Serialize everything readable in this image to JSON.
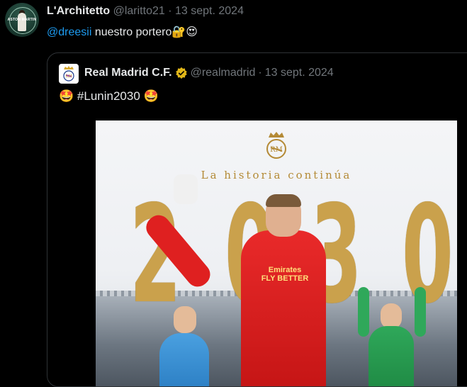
{
  "tweet": {
    "author_name": "L'Architetto",
    "handle": "@laritto21",
    "separator": "·",
    "date": "13 sept. 2024",
    "mention": "@dreesii",
    "text": "nuestro portero",
    "emojis": "🔐😍",
    "avatar_text": "ASTON MARTIN"
  },
  "quoted": {
    "author_name": "Real Madrid C.F.",
    "handle": "@realmadrid",
    "separator": "·",
    "date": "13 sept. 2024",
    "emoji_left": "🤩",
    "hashtag": "#Lunin2030",
    "emoji_right": "🤩",
    "verified_color": "#e2b719"
  },
  "media": {
    "caption": "La historia continúa",
    "digits": [
      "2",
      "0",
      "3",
      "0"
    ],
    "kit_text_line1": "Emirates",
    "kit_text_line2": "FLY BETTER"
  }
}
